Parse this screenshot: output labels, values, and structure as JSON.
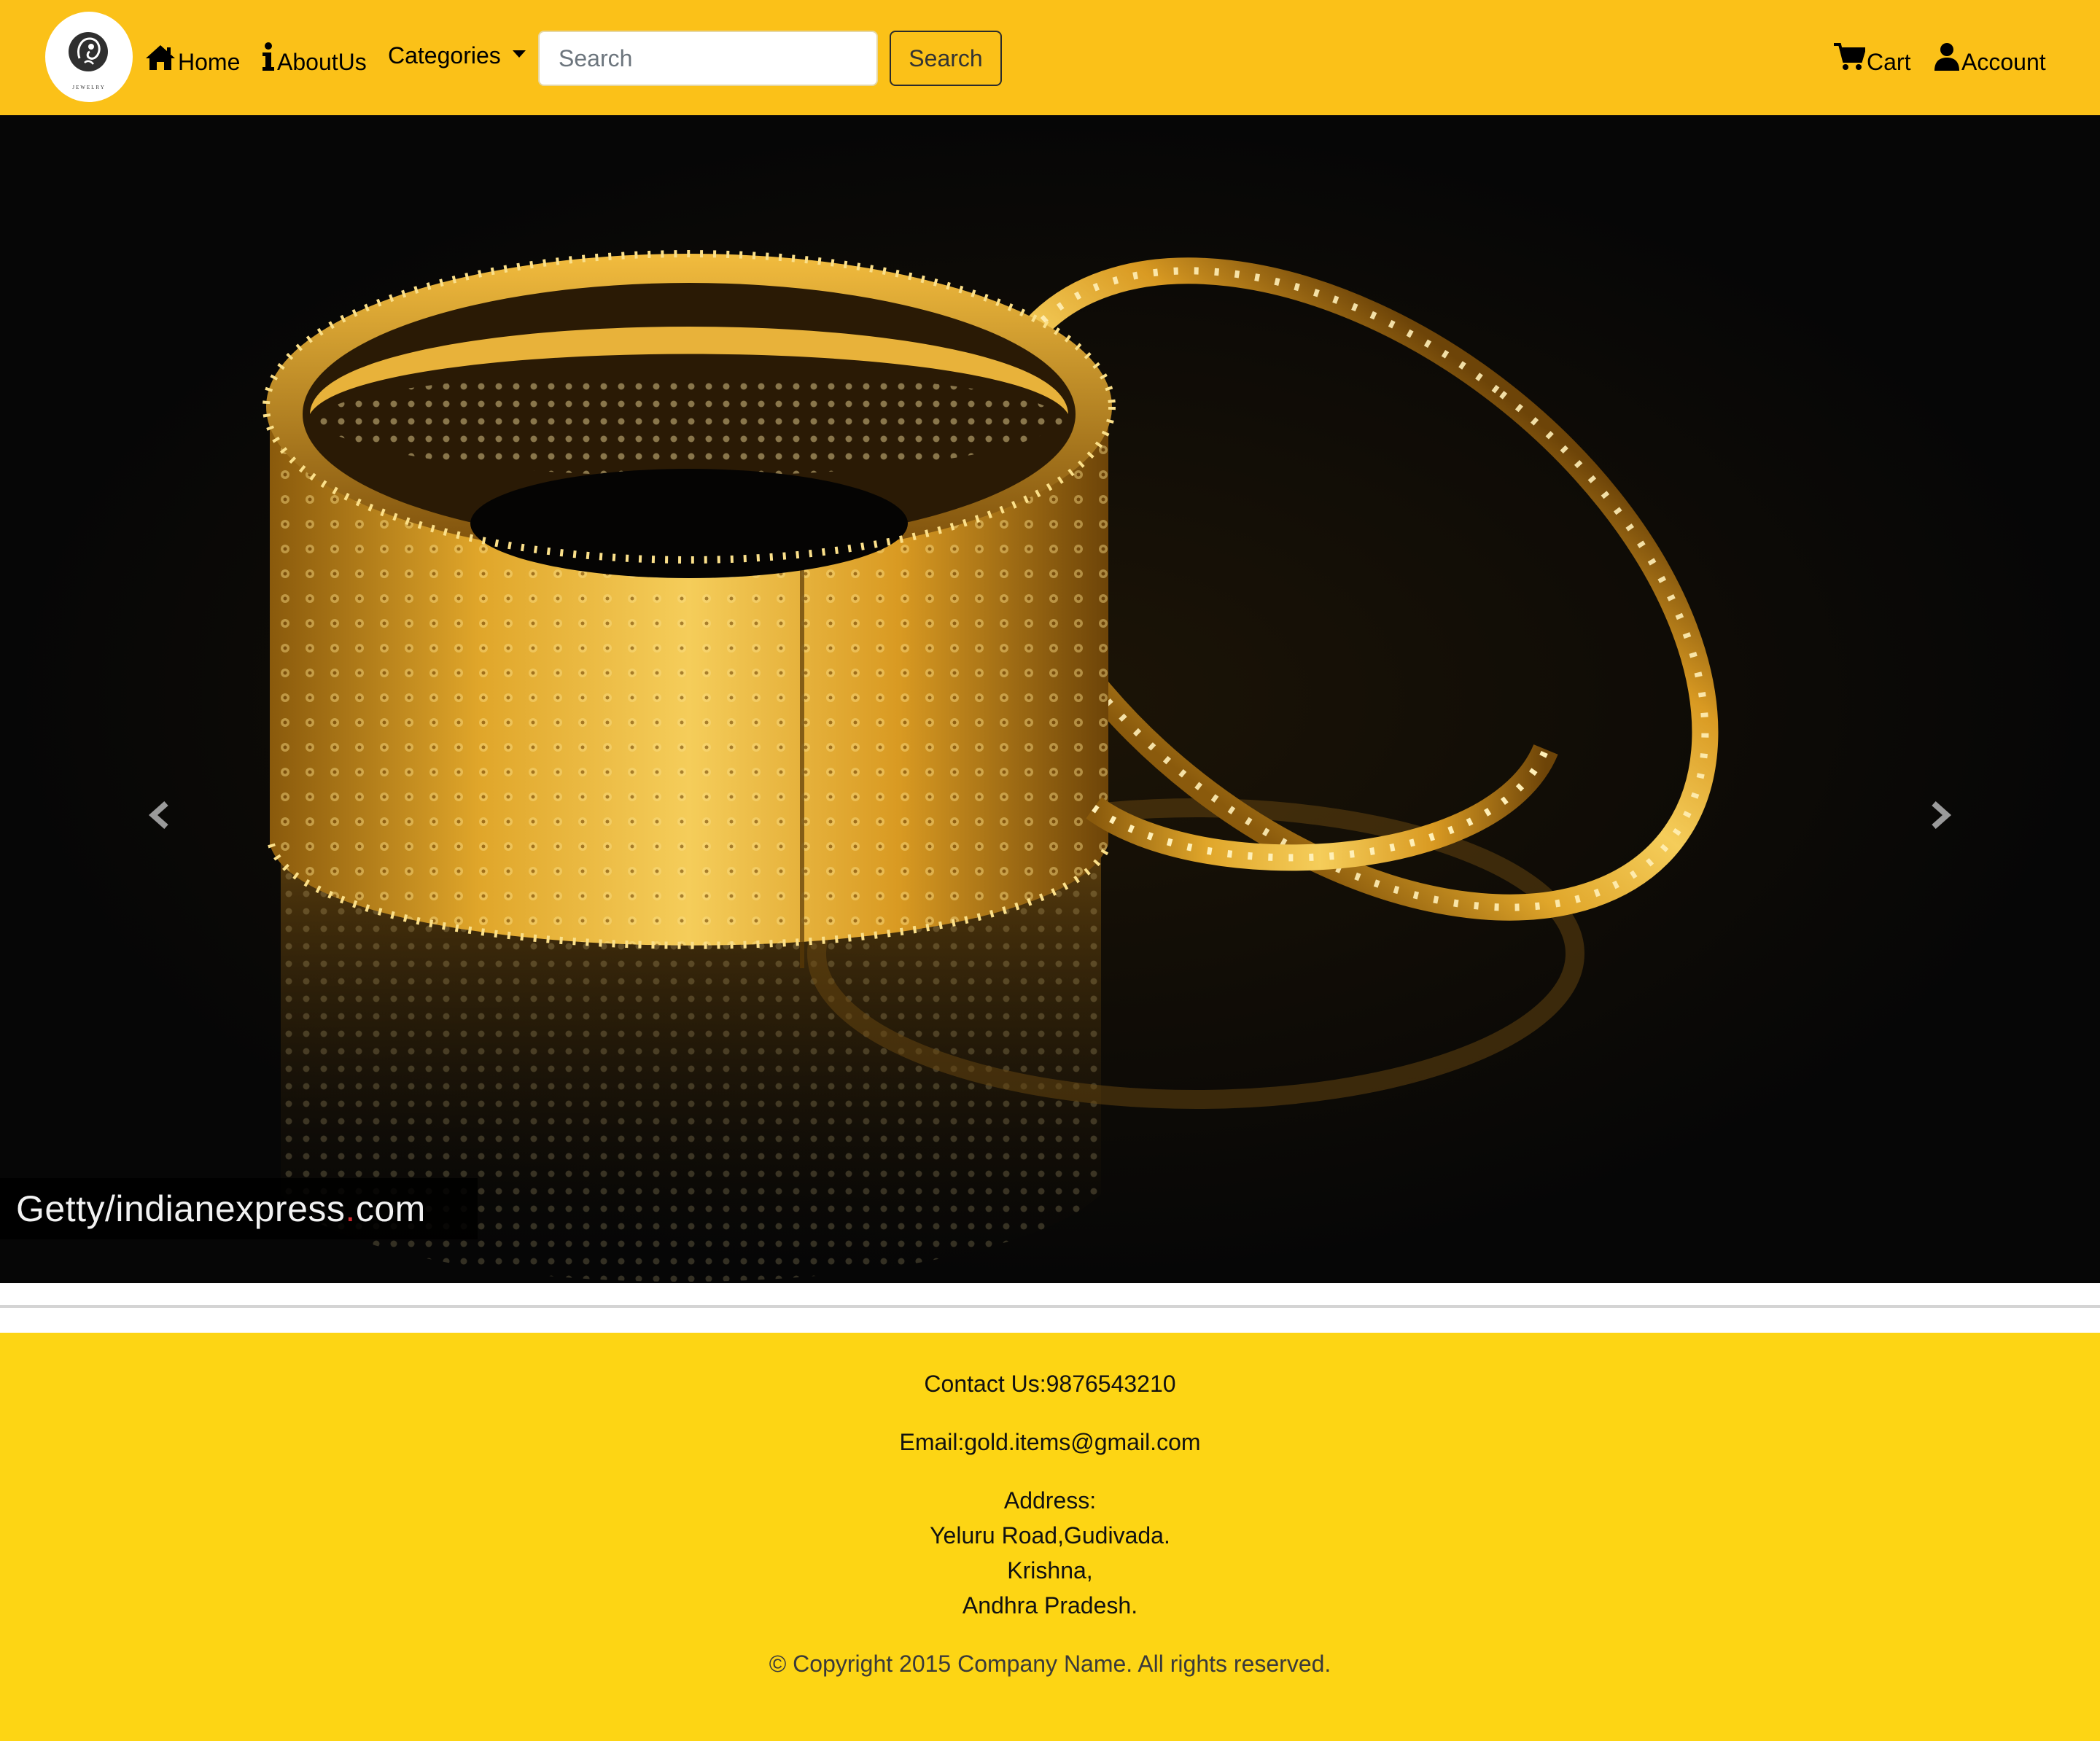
{
  "navbar": {
    "logo_icon": "jewelry-logo",
    "logo_text": "JEWELRY",
    "home_label": "Home",
    "home_icon": "home-icon",
    "about_label": "AboutUs",
    "about_icon": "info-icon",
    "categories_label": "Categories",
    "search_placeholder": "Search",
    "search_value": "",
    "search_button": "Search",
    "cart_label": "Cart",
    "cart_icon": "cart-icon",
    "account_label": "Account",
    "account_icon": "user-icon",
    "background_color": "#fbc118"
  },
  "carousel": {
    "image_description_icon": "gold-bangles-photo",
    "credit": {
      "prefix": "Getty/indianexpress",
      "dot": ".",
      "suffix": "com"
    },
    "prev_icon": "chevron-left-icon",
    "next_icon": "chevron-right-icon"
  },
  "footer": {
    "contact": "Contact Us:9876543210",
    "email": "Email:gold.items@gmail.com",
    "address_heading": "Address:",
    "address_lines": [
      "Yeluru Road,Gudivada.",
      "Krishna,",
      "Andhra Pradesh."
    ],
    "copyright": "© Copyright 2015 Company Name. All rights reserved.",
    "background_color": "#fdd514"
  }
}
